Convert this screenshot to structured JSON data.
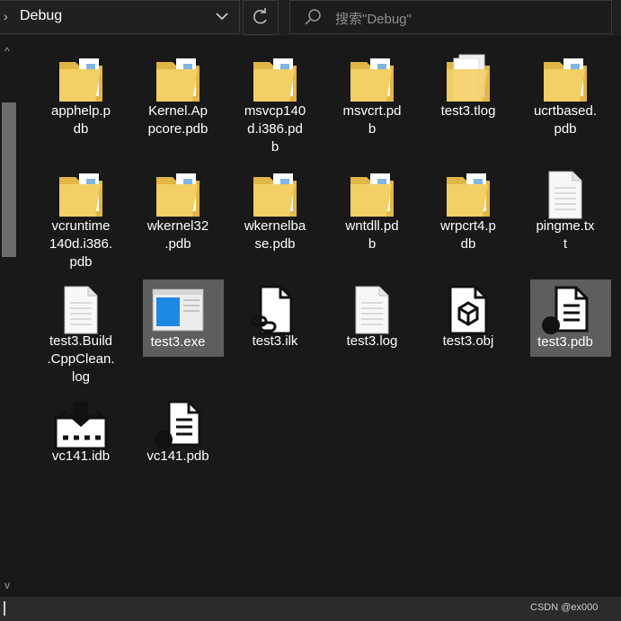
{
  "address_bar": {
    "path": "Debug"
  },
  "search": {
    "placeholder": "搜索\"Debug\""
  },
  "files": [
    {
      "name": "apphelp.p\ndb",
      "type": "folder"
    },
    {
      "name": "Kernel.Ap\npcore.pdb",
      "type": "folder"
    },
    {
      "name": "msvcp140\nd.i386.pd\nb",
      "type": "folder"
    },
    {
      "name": "msvcrt.pd\nb",
      "type": "folder"
    },
    {
      "name": "test3.tlog",
      "type": "folder-doc"
    },
    {
      "name": "ucrtbased.\npdb",
      "type": "folder"
    },
    {
      "name": "vcruntime\n140d.i386.\npdb",
      "type": "folder"
    },
    {
      "name": "wkernel32\n.pdb",
      "type": "folder"
    },
    {
      "name": "wkernelba\nse.pdb",
      "type": "folder"
    },
    {
      "name": "wntdll.pd\nb",
      "type": "folder"
    },
    {
      "name": "wrpcrt4.p\ndb",
      "type": "folder"
    },
    {
      "name": "pingme.tx\nt",
      "type": "text"
    },
    {
      "name": "test3.Build\n.CppClean.\nlog",
      "type": "text"
    },
    {
      "name": "test3.exe",
      "type": "exe",
      "selected": true
    },
    {
      "name": "test3.ilk",
      "type": "ilk"
    },
    {
      "name": "test3.log",
      "type": "text"
    },
    {
      "name": "test3.obj",
      "type": "obj"
    },
    {
      "name": "test3.pdb",
      "type": "pdb",
      "selected": true
    },
    {
      "name": "vc141.idb",
      "type": "idb"
    },
    {
      "name": "vc141.pdb",
      "type": "pdb"
    }
  ],
  "status_bar": {
    "watermark": "CSDN @ex000"
  }
}
